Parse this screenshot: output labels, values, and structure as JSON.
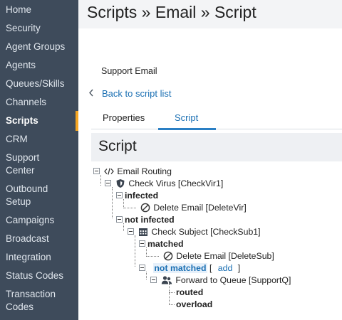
{
  "sidebar": {
    "items": [
      {
        "label": "Home"
      },
      {
        "label": "Security"
      },
      {
        "label": "Agent Groups"
      },
      {
        "label": "Agents"
      },
      {
        "label": "Queues/Skills"
      },
      {
        "label": "Channels"
      },
      {
        "label": "Scripts",
        "active": true
      },
      {
        "label": "CRM"
      },
      {
        "label": "Support",
        "label2": "Center"
      },
      {
        "label": "Outbound",
        "label2": "Setup"
      },
      {
        "label": "Campaigns"
      },
      {
        "label": "Broadcast"
      },
      {
        "label": "Integration"
      },
      {
        "label": "Status Codes"
      },
      {
        "label": "Transaction",
        "label2": "Codes"
      }
    ],
    "accent_color": "#f5a623"
  },
  "header": {
    "title": "Scripts » Email » Script"
  },
  "script_name": "Support Email",
  "back_link": "Back to script list",
  "tabs": [
    {
      "label": "Properties"
    },
    {
      "label": "Script",
      "active": true
    }
  ],
  "section_title": "Script",
  "tree": {
    "root": "Email Routing",
    "check_virus": "Check Virus [CheckVir1]",
    "infected": "infected",
    "delete_vir": "Delete Email [DeleteVir]",
    "not_infected": "not infected",
    "check_subject": "Check Subject [CheckSub1]",
    "matched": "matched",
    "delete_sub": "Delete Email [DeleteSub]",
    "not_matched": "not matched",
    "bracket_open": "[",
    "add": "add",
    "bracket_close": "]",
    "forward": "Forward to Queue [SupportQ]",
    "routed": "routed",
    "overload": "overload"
  },
  "icons": {
    "root": "code-icon",
    "check_virus": "shield-icon",
    "delete": "no-entry-icon",
    "check_subject": "calendar-grid-icon",
    "forward": "users-icon"
  }
}
